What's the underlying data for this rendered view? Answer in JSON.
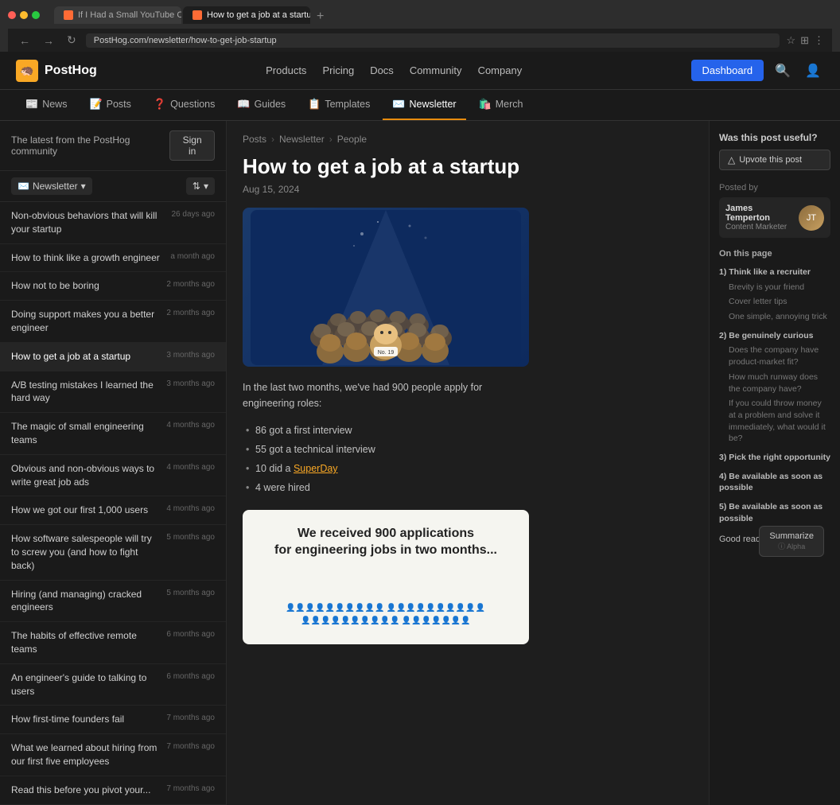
{
  "browser": {
    "tabs": [
      {
        "label": "If I Had a Small YouTube Ch...",
        "active": false,
        "favicon": "yt"
      },
      {
        "label": "How to get a job at a startup...",
        "active": true,
        "favicon": "ph"
      }
    ],
    "url": "PostHog.com/newsletter/how-to-get-job-startup",
    "nav_back": "←",
    "nav_forward": "→",
    "nav_reload": "↻"
  },
  "nav": {
    "logo": "PostHog",
    "logo_icon": "🦔",
    "links": [
      "Products",
      "Pricing",
      "Docs",
      "Community",
      "Company"
    ],
    "dashboard_btn": "Dashboard"
  },
  "subnav": {
    "items": [
      {
        "icon": "📰",
        "label": "News",
        "active": false
      },
      {
        "icon": "📝",
        "label": "Posts",
        "active": false
      },
      {
        "icon": "❓",
        "label": "Questions",
        "active": false
      },
      {
        "icon": "📖",
        "label": "Guides",
        "active": false
      },
      {
        "icon": "📋",
        "label": "Templates",
        "active": false
      },
      {
        "icon": "✉️",
        "label": "Newsletter",
        "active": true
      },
      {
        "icon": "🛍️",
        "label": "Merch",
        "active": false
      }
    ]
  },
  "sidebar": {
    "header_text": "The latest from the PostHog community",
    "sign_in": "Sign in",
    "filter_label": "Newsletter",
    "items": [
      {
        "title": "Non-obvious behaviors that will kill your startup",
        "time": "26 days ago"
      },
      {
        "title": "How to think like a growth engineer",
        "time": "a month ago"
      },
      {
        "title": "How not to be boring",
        "time": "2 months ago"
      },
      {
        "title": "Doing support makes you a better engineer",
        "time": "2 months ago"
      },
      {
        "title": "How to get a job at a startup",
        "time": "3 months ago",
        "active": true
      },
      {
        "title": "A/B testing mistakes I learned the hard way",
        "time": "3 months ago"
      },
      {
        "title": "The magic of small engineering teams",
        "time": "4 months ago"
      },
      {
        "title": "Obvious and non-obvious ways to write great job ads",
        "time": "4 months ago"
      },
      {
        "title": "How we got our first 1,000 users",
        "time": "4 months ago"
      },
      {
        "title": "How software salespeople will try to screw you (and how to fight back)",
        "time": "5 months ago"
      },
      {
        "title": "Hiring (and managing) cracked engineers",
        "time": "5 months ago"
      },
      {
        "title": "The habits of effective remote teams",
        "time": "6 months ago"
      },
      {
        "title": "An engineer's guide to talking to users",
        "time": "6 months ago"
      },
      {
        "title": "How first-time founders fail",
        "time": "7 months ago"
      },
      {
        "title": "What we learned about hiring from our first five employees",
        "time": "7 months ago"
      },
      {
        "title": "Read this before you pivot your...",
        "time": "7 months ago"
      }
    ]
  },
  "breadcrumb": {
    "items": [
      "Posts",
      "Newsletter",
      "People"
    ]
  },
  "article": {
    "title": "How to get a job at a startup",
    "date": "Aug 15, 2024",
    "intro": "In the last two months, we've had 900 people apply for engineering roles:",
    "bullets": [
      "86 got a first interview",
      "55 got a technical interview",
      "10 did a SuperDay",
      "4 were hired"
    ],
    "superday_link": "SuperDay",
    "infographic_title": "We received 900 applications\nfor engineering jobs in two months..."
  },
  "right_sidebar": {
    "useful_question": "Was this post useful?",
    "upvote_label": "Upvote this post",
    "posted_by": "Posted by",
    "author_name": "James Temperton",
    "author_role": "Content Marketer",
    "on_page_title": "On this page",
    "toc": [
      {
        "label": "1) Think like a recruiter",
        "level": 1
      },
      {
        "label": "Brevity is your friend",
        "level": 2
      },
      {
        "label": "Cover letter tips",
        "level": 2
      },
      {
        "label": "One simple, annoying trick",
        "level": 2
      },
      {
        "label": "2) Be genuinely curious",
        "level": 1
      },
      {
        "label": "Does the company have product-market fit?",
        "level": 2
      },
      {
        "label": "How much runway does the company have?",
        "level": 2
      },
      {
        "label": "If you could throw money at a problem and solve it immediately, what would it be?",
        "level": 2
      },
      {
        "label": "3) Pick the right opportunity",
        "level": 1
      },
      {
        "label": "4) Be available as soon as possible",
        "level": 1
      },
      {
        "label": "5) Be available as soon as possible",
        "level": 1
      },
      {
        "label": "Good reads 📚",
        "level": 0
      }
    ],
    "summarize_label": "Summarize",
    "summarize_sub": "ⓘ Alpha"
  }
}
